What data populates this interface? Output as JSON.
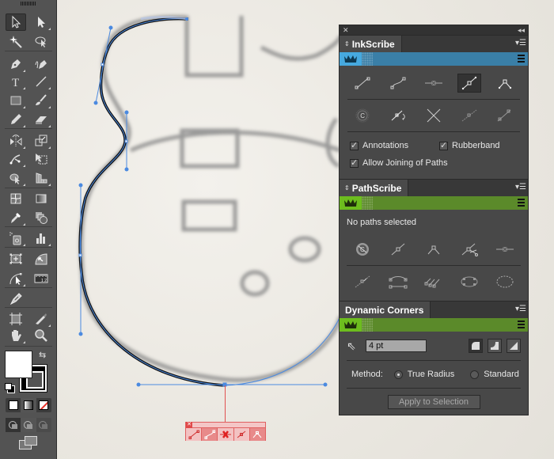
{
  "app": "Adobe Illustrator",
  "toolbar": {
    "tools": [
      {
        "name": "selection-tool",
        "active": true
      },
      {
        "name": "direct-selection-tool"
      },
      {
        "name": "magic-wand-tool"
      },
      {
        "name": "lasso-tool"
      },
      {
        "name": "pen-tool"
      },
      {
        "name": "curvature-pen-tool"
      },
      {
        "name": "type-tool"
      },
      {
        "name": "line-segment-tool"
      },
      {
        "name": "rectangle-tool"
      },
      {
        "name": "paintbrush-tool"
      },
      {
        "name": "pencil-tool"
      },
      {
        "name": "eraser-tool"
      },
      {
        "name": "reflect-tool"
      },
      {
        "name": "scale-tool"
      },
      {
        "name": "puppet-warp-tool"
      },
      {
        "name": "free-transform-tool"
      },
      {
        "name": "shape-builder-tool"
      },
      {
        "name": "perspective-grid-tool"
      },
      {
        "name": "mesh-tool"
      },
      {
        "name": "gradient-tool"
      },
      {
        "name": "eyedropper-tool"
      },
      {
        "name": "blend-tool"
      },
      {
        "name": "symbol-sprayer-tool"
      },
      {
        "name": "column-graph-tool"
      },
      {
        "name": "scribe-dynamic-tool"
      },
      {
        "name": "dynamic-corners-tool"
      },
      {
        "name": "dynamic-sketch-tool"
      },
      {
        "name": "ruler-tool"
      },
      {
        "name": "inkscribe-tool"
      },
      {
        "name": "artboard-tool"
      },
      {
        "name": "slice-tool"
      },
      {
        "name": "hand-tool"
      },
      {
        "name": "zoom-tool"
      }
    ],
    "fill_color": "#ffffff",
    "stroke_color": "#000000"
  },
  "panels": {
    "inkscribe": {
      "tab_label": "InkScribe",
      "banner_color": "#3a7fa7",
      "row1_icons": [
        "line-segment-icon",
        "curve-segment-icon",
        "delete-anchor-icon",
        "smooth-anchor-icon",
        "corner-anchor-icon"
      ],
      "row1_selected": 3,
      "row2_icons": [
        "close-path-icon",
        "rotate-handle-icon",
        "cross-icon",
        "retract-handle-icon",
        "extend-handle-icon"
      ],
      "checkboxes": [
        {
          "label": "Annotations",
          "checked": true
        },
        {
          "label": "Rubberband",
          "checked": true
        },
        {
          "label": "Allow Joining of Paths",
          "checked": true
        }
      ]
    },
    "pathscribe": {
      "tab_label": "PathScribe",
      "banner_color": "#5b8a2a",
      "status": "No paths selected",
      "row1_icons": [
        "close-path-icon",
        "smooth-anchor-icon",
        "corner-anchor-icon",
        "cut-anchor-icon",
        "delete-anchor-icon"
      ],
      "row2_icons": [
        "retract-handles-icon",
        "align-anchors-icon",
        "smooth-points-icon",
        "simplify-path-icon",
        "add-points-icon"
      ]
    },
    "dynamic_corners": {
      "tab_label": "Dynamic Corners",
      "banner_color": "#5b8a2a",
      "radius_value": "4 pt",
      "corner_styles": [
        "round-corner-icon",
        "inverted-corner-icon",
        "chamfer-corner-icon"
      ],
      "corner_style_selected": 0,
      "method_label": "Method:",
      "methods": [
        {
          "label": "True Radius",
          "selected": true
        },
        {
          "label": "Standard",
          "selected": false
        }
      ],
      "apply_button": "Apply to Selection"
    }
  },
  "mini_toolbar": {
    "buttons": [
      "line-segment-icon",
      "curve-segment-icon",
      "delete-anchor-icon",
      "smooth-anchor-icon",
      "corner-anchor-icon"
    ],
    "selected": 1
  }
}
